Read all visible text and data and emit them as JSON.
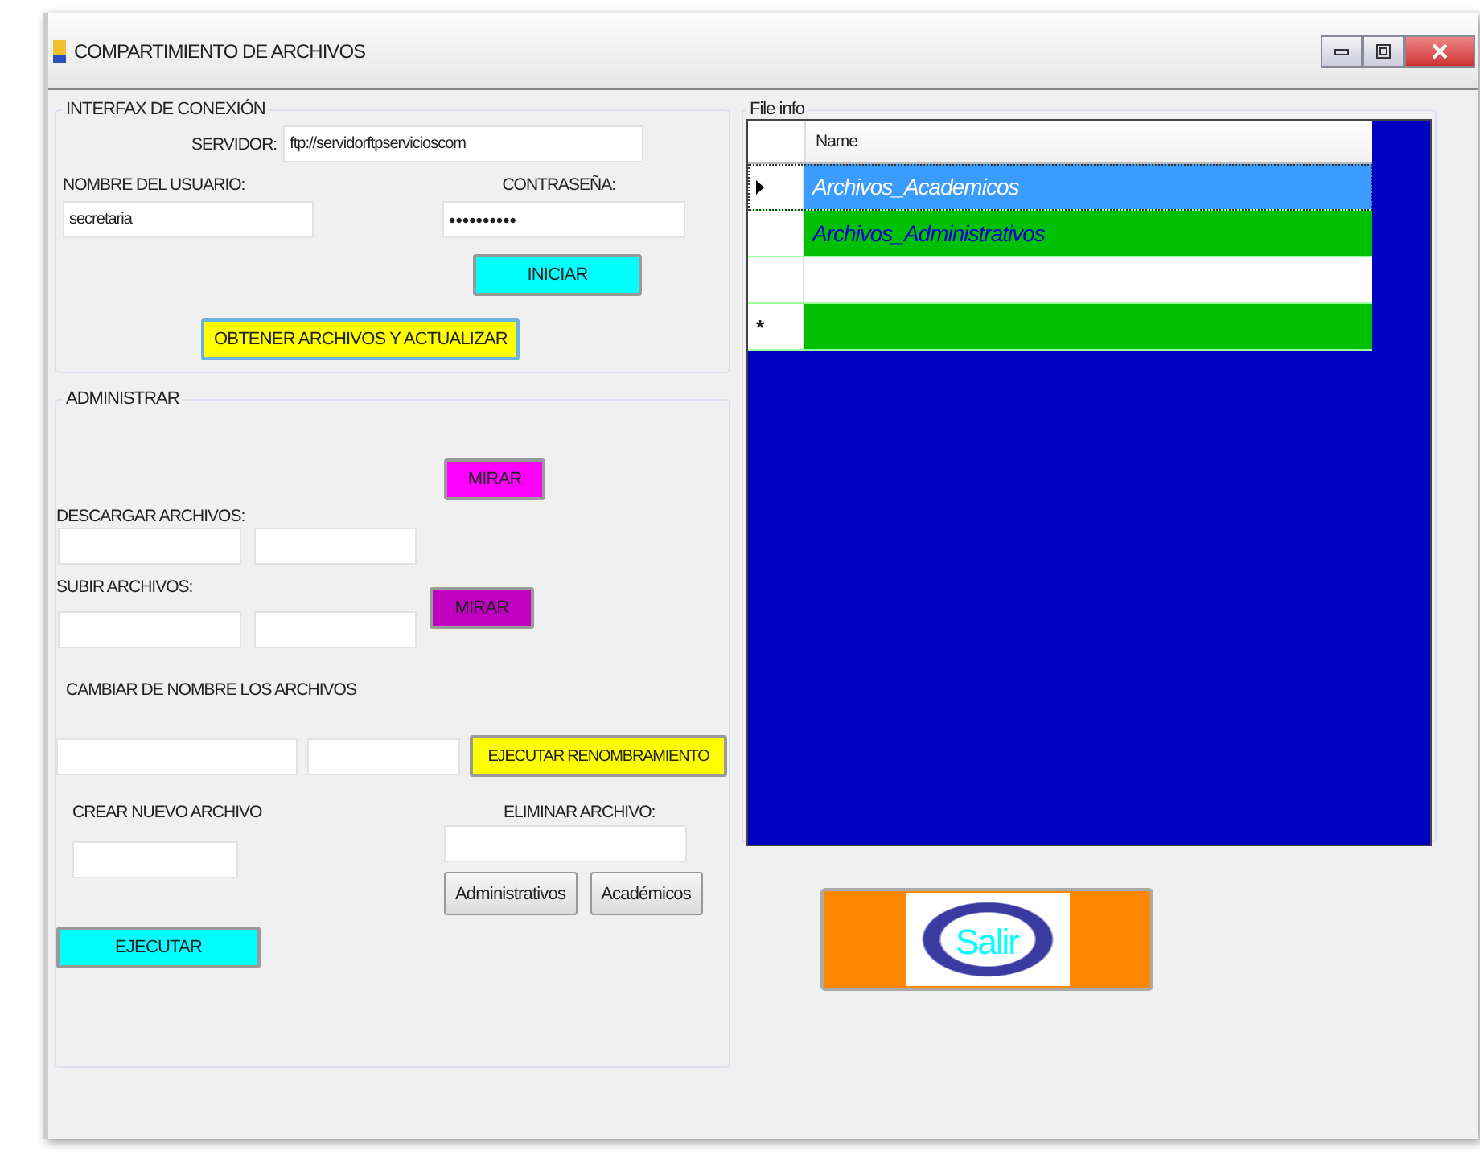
{
  "window": {
    "title": "COMPARTIMIENTO DE ARCHIVOS"
  },
  "connection": {
    "legend": "INTERFAX DE CONEXIÓN",
    "server_label": "SERVIDOR:",
    "server_value": "ftp://servidorftpservicioscom",
    "user_label": "NOMBRE DEL USUARIO:",
    "user_value": "secretaria",
    "password_label": "CONTRASEÑA:",
    "password_value": "••••••••••",
    "start_button": "INICIAR",
    "fetch_button": "OBTENER ARCHIVOS Y  ACTUALIZAR"
  },
  "admin": {
    "legend": "ADMINISTRAR",
    "download_label": "DESCARGAR ARCHIVOS:",
    "download_button": "MIRAR",
    "upload_label": "SUBIR ARCHIVOS:",
    "upload_button": "MIRAR",
    "rename_label": "CAMBIAR DE NOMBRE LOS ARCHIVOS",
    "rename_button": "EJECUTAR  RENOMBRAMIENTO",
    "create_label": "CREAR NUEVO ARCHIVO",
    "create_button": "EJECUTAR",
    "delete_label": "ELIMINAR ARCHIVO:",
    "delete_buttons": [
      "Administrativos",
      "Académicos"
    ]
  },
  "file_info": {
    "legend": "File info",
    "columns": [
      "Name"
    ],
    "rows": [
      {
        "kind": "current",
        "marker": "",
        "name": "Archivos_Academicos",
        "selected": true,
        "color": "#3a9cff"
      },
      {
        "kind": "normal",
        "marker": "",
        "name": "Archivos_Administrativos",
        "selected": false,
        "color": "#00c000"
      },
      {
        "kind": "normal",
        "marker": "",
        "name": "",
        "selected": false,
        "color": "#ffffff"
      },
      {
        "kind": "new",
        "marker": "*",
        "name": "",
        "selected": false,
        "color": "#00c000"
      }
    ]
  },
  "exit_button": "Salir"
}
